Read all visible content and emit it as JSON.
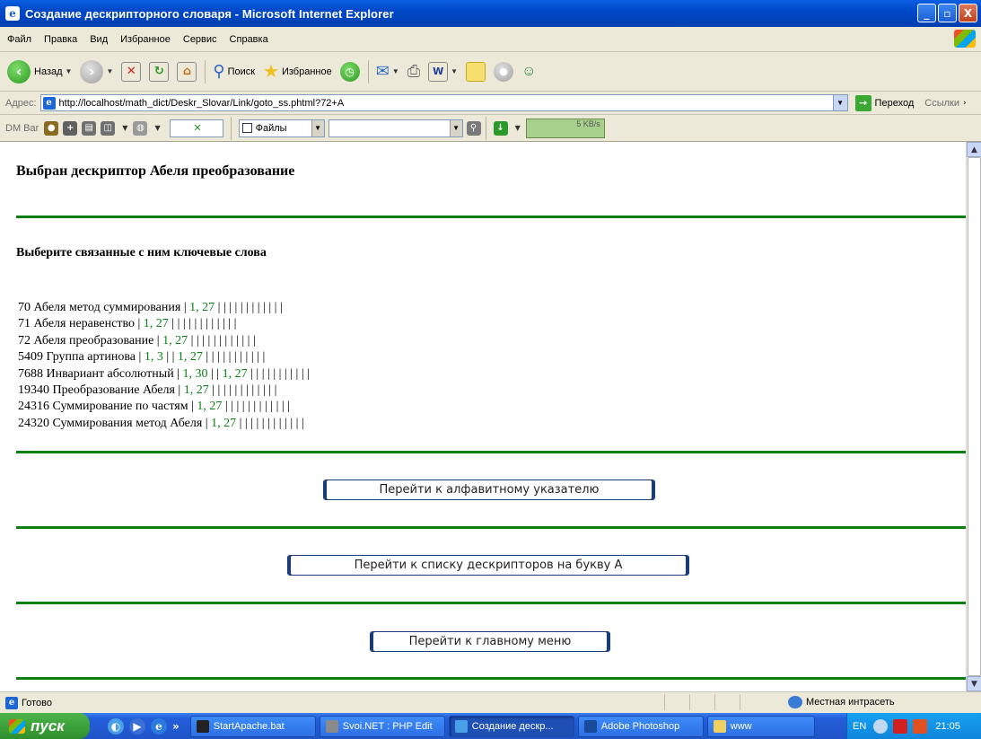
{
  "window": {
    "title": "Создание дескрипторного словаря - Microsoft Internet Explorer",
    "minimize": "_",
    "maximize": "▫",
    "close": "X"
  },
  "menu": [
    "Файл",
    "Правка",
    "Вид",
    "Избранное",
    "Сервис",
    "Справка"
  ],
  "toolbar": {
    "back": "Назад",
    "search": "Поиск",
    "favorites": "Избранное"
  },
  "address": {
    "label": "Адрес:",
    "url": "http://localhost/math_dict/Deskr_Slovar/Link/goto_ss.phtml?72+A",
    "go": "Переход",
    "links": "Ссылки"
  },
  "dmbar": {
    "label": "DM Bar",
    "files": "Файлы",
    "speed": "5 KB/s"
  },
  "page": {
    "heading": "Выбран дескриптор Абеля преобразование",
    "subheading": "Выберите связанные с ним ключевые слова",
    "items": [
      {
        "text": "70 Абеля метод суммирования | ",
        "ref": "1, 27",
        "tail": " | | | | | | | | | | | |"
      },
      {
        "text": "71 Абеля неравенство | ",
        "ref": "1, 27",
        "tail": " | | | | | | | | | | | |"
      },
      {
        "text": "72 Абеля преобразование | ",
        "ref": "1, 27",
        "tail": " | | | | | | | | | | | |"
      },
      {
        "text": "5409 Группа артинова | ",
        "ref": "1, 3",
        "mid": " | | ",
        "ref2": "1, 27",
        "tail": " | | | | | | | | | | |"
      },
      {
        "text": "7688 Инвариант абсолютный | ",
        "ref": "1, 30",
        "mid": " | | ",
        "ref2": "1, 27",
        "tail": " | | | | | | | | | | |"
      },
      {
        "text": "19340 Преобразование Абеля | ",
        "ref": "1, 27",
        "tail": " | | | | | | | | | | | |"
      },
      {
        "text": "24316 Суммирование по частям | ",
        "ref": "1, 27",
        "tail": " | | | | | | | | | | | |"
      },
      {
        "text": "24320 Суммирования метод Абеля | ",
        "ref": "1, 27",
        "tail": " | | | | | | | | | | | |"
      }
    ],
    "btn_alpha": "Перейти к алфавитному указателю",
    "btn_list": "Перейти к списку дескрипторов на букву А",
    "btn_main": "Перейти к главному меню"
  },
  "status": {
    "text": "Готово",
    "zone": "Местная интрасеть"
  },
  "taskbar": {
    "start": "пуск",
    "more": "»",
    "tasks": [
      "StartApache.bat",
      "Svoi.NET : PHP Edit",
      "Создание дескр...",
      "Adobe Photoshop",
      "www"
    ],
    "lang": "EN",
    "time": "21:05"
  },
  "colors": {
    "rule_green": "#0c7f12",
    "ref_green": "#0c7f12",
    "title_blue": "#0048c8"
  }
}
